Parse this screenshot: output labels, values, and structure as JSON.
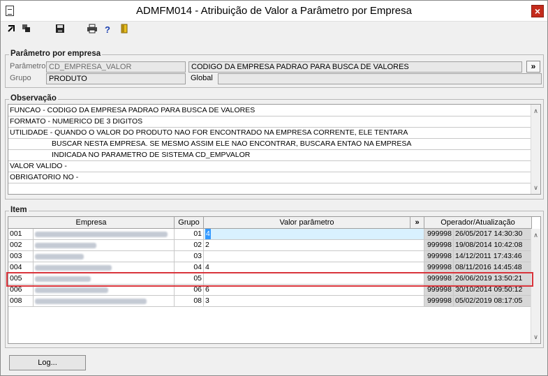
{
  "window": {
    "title": "ADMFM014 - Atribuição de Valor a Parâmetro por Empresa",
    "close": "×"
  },
  "toolbar": {
    "icons": [
      "arrow-in-icon",
      "copy-icon",
      "save-icon",
      "print-icon",
      "help-icon",
      "exit-door-icon"
    ],
    "help_glyph": "?"
  },
  "parametro": {
    "legend": "Parâmetro por empresa",
    "label_parametro": "Parâmetro",
    "parametro_value": "CD_EMPRESA_VALOR",
    "descricao_value": "CODIGO DA EMPRESA PADRAO PARA BUSCA DE VALORES",
    "more": "»",
    "label_grupo": "Grupo",
    "grupo_value": "PRODUTO",
    "label_global": "Global",
    "global_value": ""
  },
  "observacao": {
    "legend": "Observação",
    "lines": [
      "FUNCAO - CODIGO DA EMPRESA PADRAO PARA BUSCA DE VALORES",
      "FORMATO - NUMERICO DE 3 DIGITOS",
      "UTILIDADE - QUANDO O VALOR DO PRODUTO NAO FOR ENCONTRADO NA EMPRESA CORRENTE, ELE TENTARA",
      "BUSCAR NESTA EMPRESA. SE MESMO ASSIM ELE NAO ENCONTRAR, BUSCARA ENTAO NA EMPRESA",
      "INDICADA NO PARAMETRO DE SISTEMA CD_EMPVALOR",
      "VALOR VALIDO -",
      "OBRIGATORIO NO -"
    ]
  },
  "item": {
    "legend": "Item",
    "headers": {
      "empresa": "Empresa",
      "grupo": "Grupo",
      "valor": "Valor parâmetro",
      "more": "»",
      "operador": "Operador/Atualização"
    },
    "rows": [
      {
        "empresa": "001",
        "grupo": "01",
        "valor": "4",
        "operador": "999998",
        "atualizacao": "26/05/2017 14:30:30"
      },
      {
        "empresa": "002",
        "grupo": "02",
        "valor": "2",
        "operador": "999998",
        "atualizacao": "19/08/2014 10:42:08"
      },
      {
        "empresa": "003",
        "grupo": "03",
        "valor": "",
        "operador": "999998",
        "atualizacao": "14/12/2011 17:43:46"
      },
      {
        "empresa": "004",
        "grupo": "04",
        "valor": "4",
        "operador": "999998",
        "atualizacao": "08/11/2016 14:45:48"
      },
      {
        "empresa": "005",
        "grupo": "05",
        "valor": "",
        "operador": "999998",
        "atualizacao": "26/06/2019 13:50:21"
      },
      {
        "empresa": "006",
        "grupo": "06",
        "valor": "6",
        "operador": "999998",
        "atualizacao": "30/10/2014 09:50:12"
      },
      {
        "empresa": "008",
        "grupo": "08",
        "valor": "3",
        "operador": "999998",
        "atualizacao": "05/02/2019 08:17:05"
      }
    ]
  },
  "log_button": "Log...",
  "colors": {
    "highlight": "#d9343b",
    "selected_cell": "#d9f1ff",
    "close": "#c42b1c"
  }
}
